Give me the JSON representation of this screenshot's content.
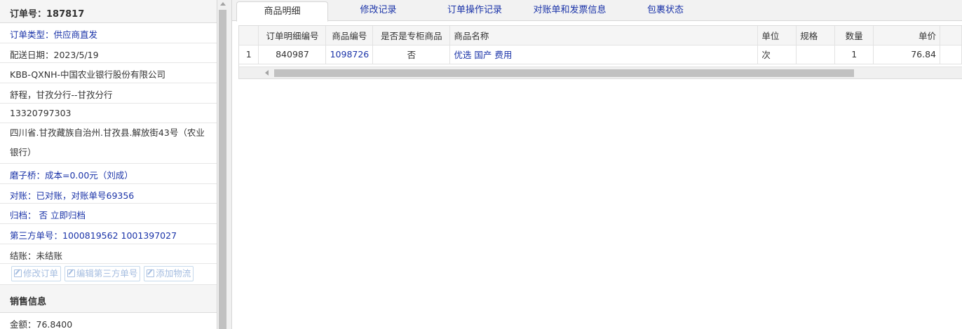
{
  "order": {
    "title": "订单号：187817",
    "info_rows": [
      "订单类型：供应商直发",
      "配送日期：2023/5/19",
      "KBB-QXNH-中国农业银行股份有限公司",
      "舒程，甘孜分行--甘孜分行",
      "13320797303",
      "四川省.甘孜藏族自治州.甘孜县.解放街43号（农业银行）",
      "磨子桥：成本=0.00元（刘成）",
      "对账：已对账，对账单号69356",
      "归档： 否 立即归档",
      "第三方单号：1000819562 1001397027",
      "结账：未结账"
    ],
    "actions": {
      "edit_order": "修改订单",
      "edit_third_party": "编辑第三方单号",
      "add_logistics": "添加物流"
    }
  },
  "sales": {
    "title": "销售信息",
    "amount": "金额：76.8400"
  },
  "tabs": [
    {
      "label": "商品明细",
      "active": true
    },
    {
      "label": "修改记录",
      "active": false
    },
    {
      "label": "订单操作记录",
      "active": false
    },
    {
      "label": "对账单和发票信息",
      "active": false
    },
    {
      "label": "包裹状态",
      "active": false
    }
  ],
  "grid": {
    "columns": [
      "订单明细编号",
      "商品编号",
      "是否是专柜商品",
      "商品名称",
      "单位",
      "规格",
      "数量",
      "单价"
    ],
    "rows": [
      {
        "index": "1",
        "detail_id": "840987",
        "product_id": "1098726",
        "is_counter": "否",
        "name": "优选 国产 费用",
        "unit": "次",
        "spec": "",
        "qty": "1",
        "price": "76.84"
      }
    ]
  },
  "colors": {
    "link": "#1a33a8",
    "disabled_button": "#a5bde0",
    "header_bg": "#f5f5f5"
  }
}
